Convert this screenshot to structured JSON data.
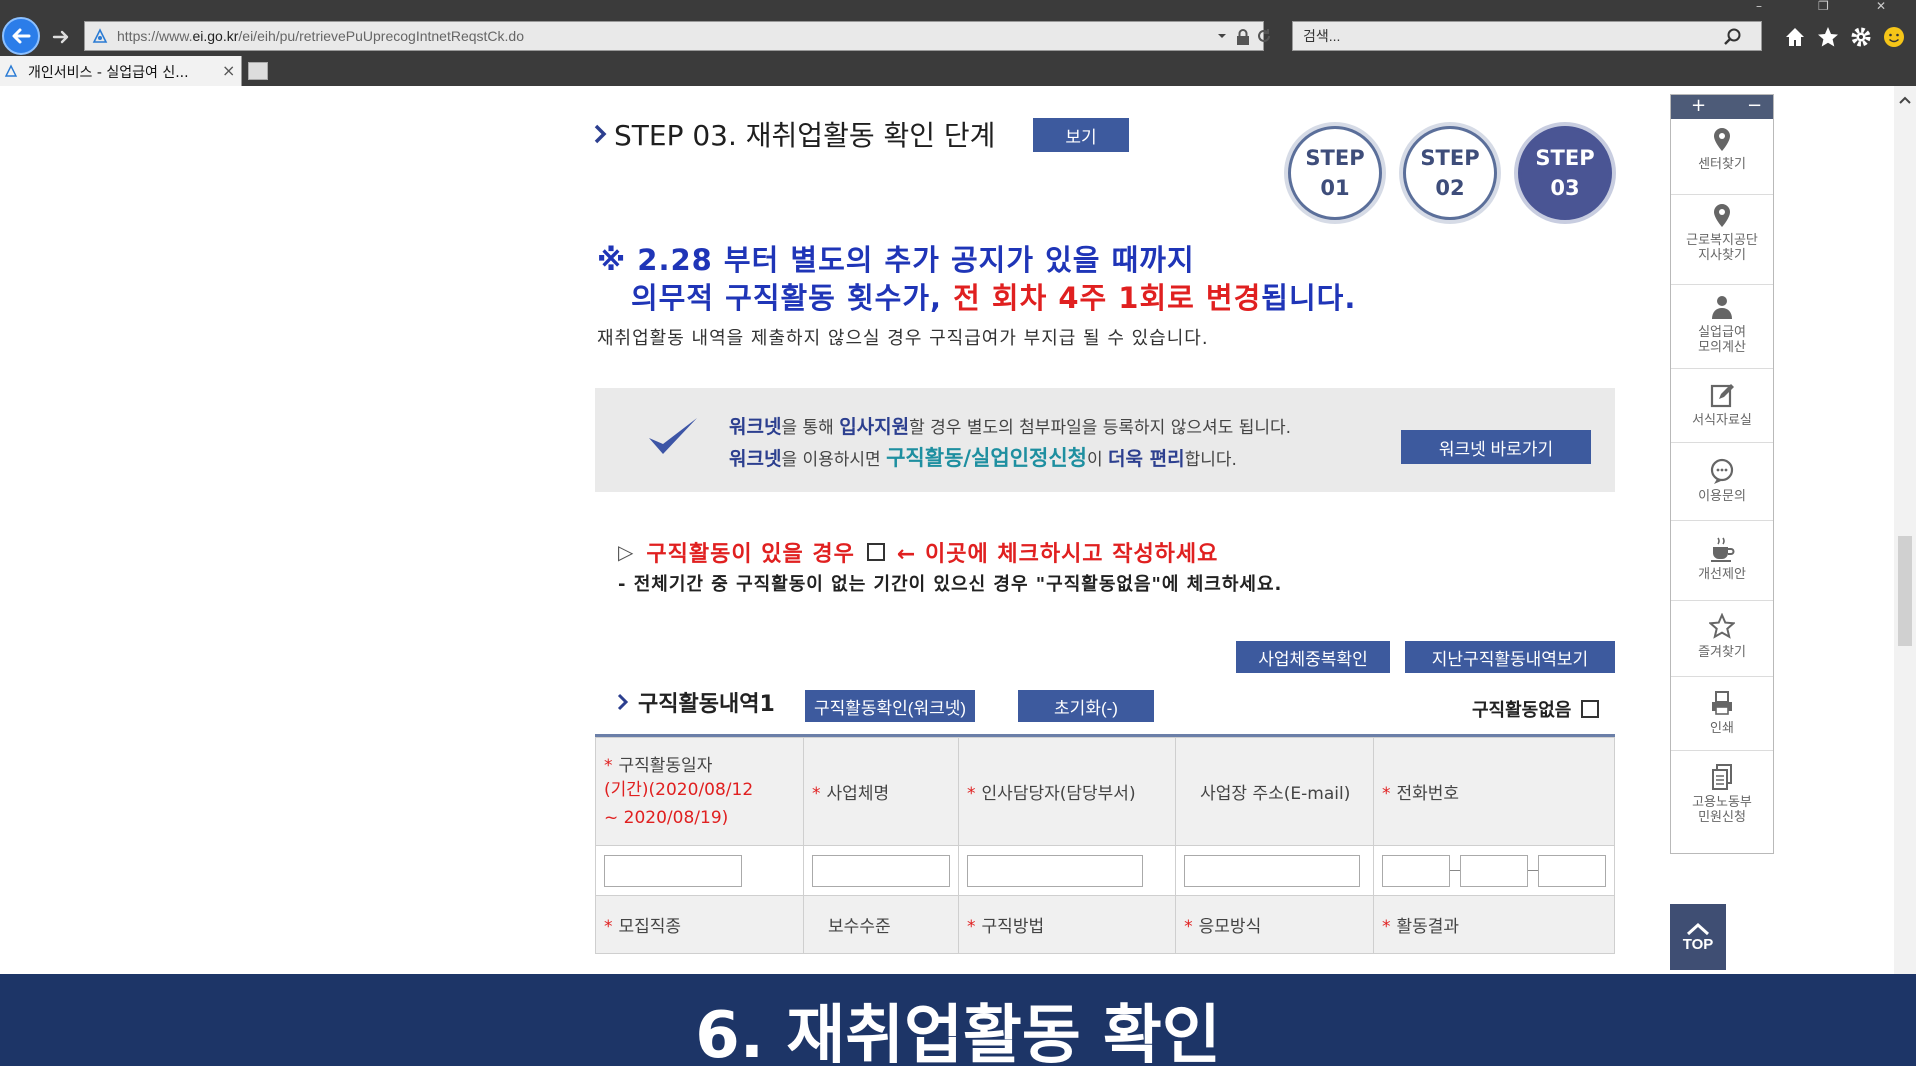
{
  "browser": {
    "url_prefix": "https://www.",
    "url_domain": "ei.go.kr",
    "url_path": "/ei/eih/pu/retrievePuUprecogIntnetReqstCk.do",
    "search_placeholder": "검색...",
    "tab_title": "개인서비스 - 실업급여 신...",
    "tab_close": "×",
    "win_minimize": "–",
    "win_restore": "❐",
    "win_close": "✕"
  },
  "step": {
    "title": "STEP 03. 재취업활동 확인 단계",
    "view_button": "보기",
    "circles": [
      {
        "line1": "STEP",
        "line2": "01"
      },
      {
        "line1": "STEP",
        "line2": "02"
      },
      {
        "line1": "STEP",
        "line2": "03"
      }
    ]
  },
  "notice": {
    "line1": "※ 2.28 부터 별도의 추가 공지가 있을 때까지",
    "line2_a": "의무적 구직활동 횟수가, ",
    "line2_red": "전 회차 4주 1회로 변경",
    "line2_b": "됩니다.",
    "sub": "재취업활동 내역을 제출하지 않으실 경우 구직급여가 부지급 될 수 있습니다."
  },
  "worknet_box": {
    "l1_a": "워크넷",
    "l1_b": "을 통해 ",
    "l1_c": "입사지원",
    "l1_d": "할 경우 별도의 첨부파일을 등록하지 않으셔도 됩니다.",
    "l2_a": "워크넷",
    "l2_b": "을 이용하시면 ",
    "l2_c": "구직활동/실업인정신청",
    "l2_d": "이 ",
    "l2_e": "더욱 편리",
    "l2_f": "합니다.",
    "button": "워크넷 바로가기"
  },
  "activity_note": {
    "prefix": "▷",
    "text_a": "구직활동이 있을 경우",
    "text_b": "← 이곳에 체크하시고 작성하세요",
    "line2": "- 전체기간 중 구직활동이 없는 기간이 있으신 경우 \"구직활동없음\"에 체크하세요."
  },
  "buttons": {
    "dup_check": "사업체중복확인",
    "past_history": "지난구직활동내역보기",
    "confirm_worknet": "구직활동확인(워크넷)",
    "reset": "초기화(-)"
  },
  "list": {
    "title": "구직활동내역1",
    "no_activity": "구직활동없음"
  },
  "table": {
    "required_mark": "*",
    "date_label": "구직활동일자",
    "period_line1": "(기간)(2020/08/12",
    "period_line2": "~ 2020/08/19)",
    "company": "사업체명",
    "hr_contact": "인사담당자(담당부서)",
    "address": "사업장 주소(E-mail)",
    "phone": "전화번호",
    "job_type": "모집직종",
    "salary": "보수수준",
    "search_method": "구직방법",
    "apply_method": "응모방식",
    "result": "활동결과"
  },
  "quickmenu": {
    "plus": "+",
    "minus": "−",
    "items": [
      {
        "label": "센터찾기",
        "icon": "map-pin-icon"
      },
      {
        "label": "근로복지공단\n지사찾기",
        "icon": "map-pin-icon"
      },
      {
        "label": "실업급여\n모의계산",
        "icon": "person-icon"
      },
      {
        "label": "서식자료실",
        "icon": "edit-icon"
      },
      {
        "label": "이용문의",
        "icon": "chat-icon"
      },
      {
        "label": "개선제안",
        "icon": "cup-icon"
      },
      {
        "label": "즐겨찾기",
        "icon": "star-icon"
      },
      {
        "label": "인쇄",
        "icon": "print-icon"
      },
      {
        "label": "고용노동부\n민원신청",
        "icon": "document-icon"
      }
    ],
    "top": "TOP"
  },
  "caption": "6. 재취업활동 확인",
  "colors": {
    "navy_button": "#3d5a9e",
    "notice_blue": "#1f35b7",
    "alert_red": "#e02020",
    "caption_bg": "#1d3567"
  }
}
